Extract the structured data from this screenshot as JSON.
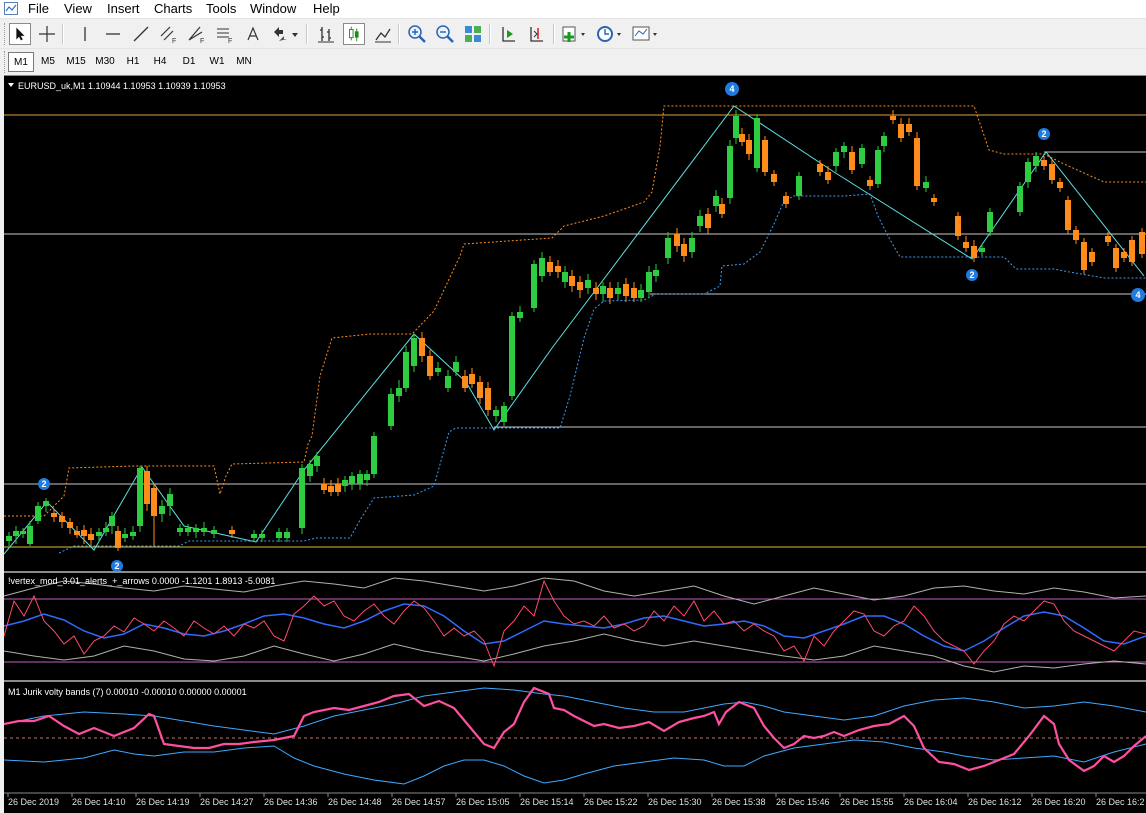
{
  "menu": {
    "items": [
      "File",
      "View",
      "Insert",
      "Charts",
      "Tools",
      "Window",
      "Help"
    ]
  },
  "toolbar": {
    "timeframes": [
      "M1",
      "M5",
      "M15",
      "M30",
      "H1",
      "H4",
      "D1",
      "W1",
      "MN"
    ],
    "active_timeframe": "M1",
    "tools": [
      "cursor-icon",
      "crosshair-icon",
      "vertical-line-icon",
      "horizontal-line-icon",
      "trendline-icon",
      "fibonacci-channel-icon",
      "fibonacci-fan-icon",
      "fibonacci-retracement-icon",
      "text-label-icon",
      "arrows-icon",
      "bar-chart-icon",
      "candlestick-icon",
      "line-chart-icon",
      "zoom-in-icon",
      "zoom-out-icon",
      "tile-windows-icon",
      "auto-scroll-icon",
      "chart-shift-icon",
      "indicators-icon",
      "periods-icon",
      "templates-icon"
    ]
  },
  "chart": {
    "main_header": "EURUSD_uk,M1  1.10944 1.10953 1.10939 1.10953",
    "indicator1_header": "!vertex_mod_3.01_alerts_+_arrows 0.0000 -1.1201 1.8913 -5.0081",
    "indicator2_header": "M1 Jurik volty bands (7) 0.00010 -0.00010 0.00000 0.00001",
    "time_labels": [
      "26 Dec 2019",
      "26 Dec 14:10",
      "26 Dec 14:19",
      "26 Dec 14:27",
      "26 Dec 14:36",
      "26 Dec 14:48",
      "26 Dec 14:57",
      "26 Dec 15:05",
      "26 Dec 15:14",
      "26 Dec 15:22",
      "26 Dec 15:30",
      "26 Dec 15:38",
      "26 Dec 15:46",
      "26 Dec 15:55",
      "26 Dec 16:04",
      "26 Dec 16:12",
      "26 Dec 16:20",
      "26 Dec 16:2"
    ],
    "swing_labels": [
      "4",
      "2",
      "2",
      "2",
      "4",
      "2"
    ],
    "colors": {
      "background": "#000000",
      "bull": "#2ecc40",
      "bear": "#ff8c1a",
      "zigzag": "#5fe0e0",
      "upper_channel": "#ff8c1a",
      "lower_channel": "#3c9cf0",
      "pink": "#ff4fa0",
      "blue": "#3fa8ff",
      "swing_badge": "#1e7be0"
    }
  }
}
